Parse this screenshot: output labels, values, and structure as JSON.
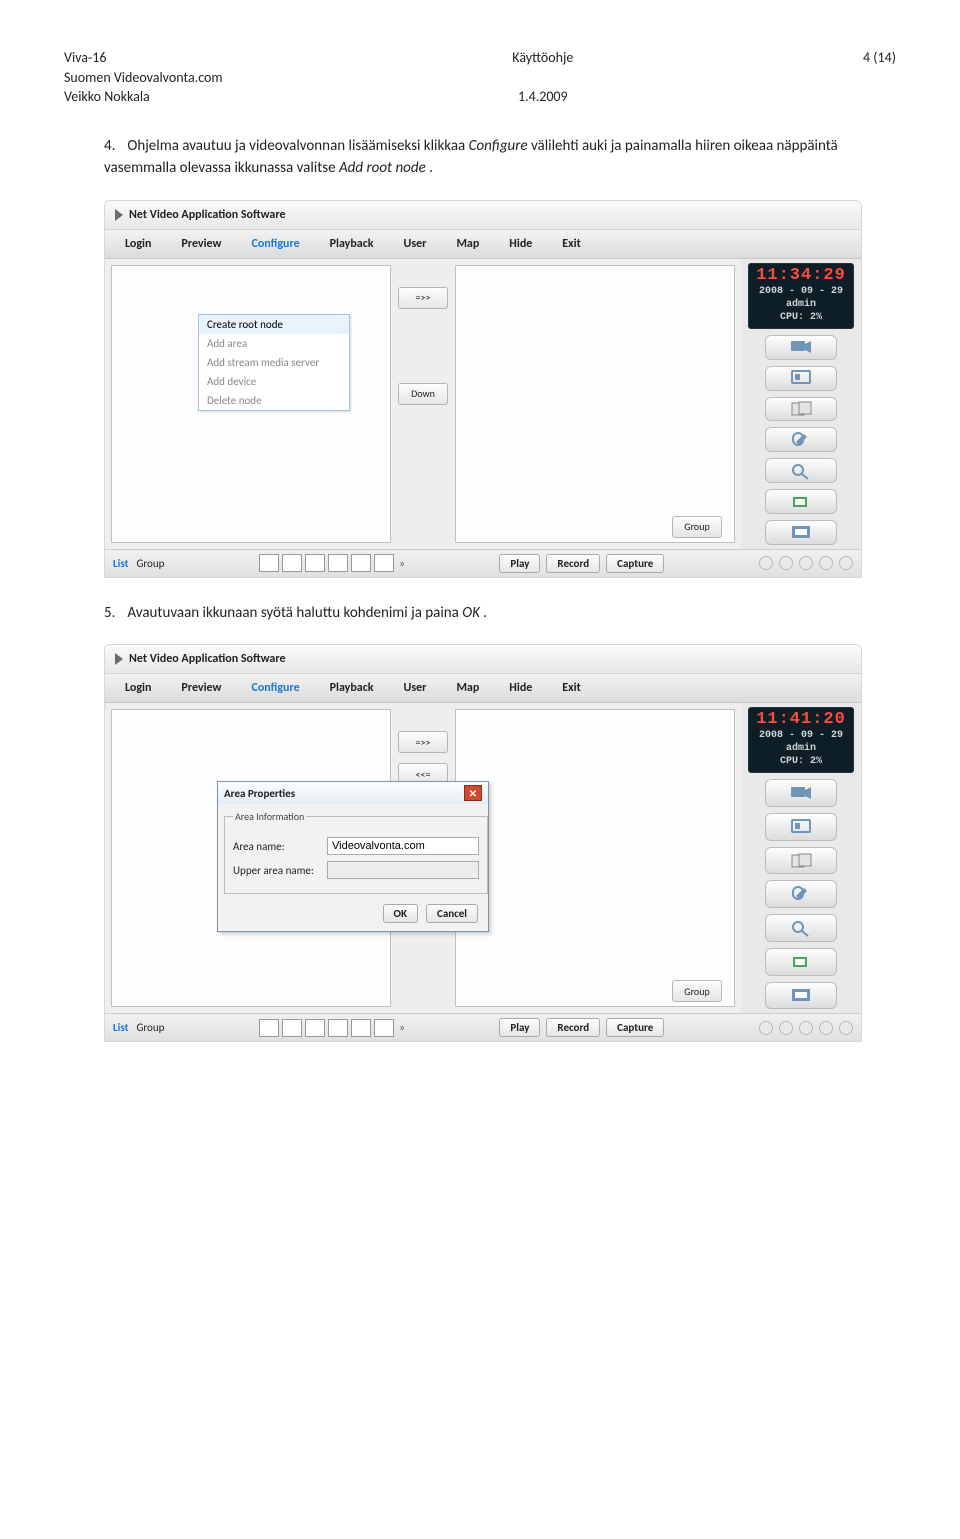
{
  "header": {
    "left_line1": "Viva-16",
    "left_line2": "Suomen Videovalvonta.com",
    "left_line3": "Veikko Nokkala",
    "center_line1": "Käyttöohje",
    "center_line2": "1.4.2009",
    "right_line1": "4 (14)"
  },
  "para4": {
    "num": "4.",
    "t1": "Ohjelma avautuu ja videovalvonnan lisäämiseksi klikkaa ",
    "em1": "Configure",
    "t2": " välilehti auki ja painamalla hiiren oikeaa näppäintä vasemmalla olevassa ikkunassa valitse ",
    "em2": "Add root node",
    "t3": "."
  },
  "para5": {
    "num": "5.",
    "t1": "Avautuvaan ikkunaan syötä haluttu kohdenimi ja paina ",
    "em1": "OK",
    "t2": "."
  },
  "app": {
    "title": "Net Video Application Software",
    "menu": {
      "login": "Login",
      "preview": "Preview",
      "configure": "Configure",
      "playback": "Playback",
      "user": "User",
      "map": "Map",
      "hide": "Hide",
      "exit": "Exit"
    },
    "small": {
      "fwd": "=>>",
      "back": "<<=",
      "down": "Down",
      "group": "Group"
    },
    "footer": {
      "tabs": {
        "list": "List",
        "group": "Group"
      },
      "play": "Play",
      "record": "Record",
      "capture": "Capture",
      "chev": "»"
    }
  },
  "lcd1": {
    "time": "11:34:29",
    "date": "2008 - 09 - 29",
    "user": "admin",
    "cpu": "CPU: 2%"
  },
  "lcd2": {
    "time": "11:41:20",
    "date": "2008 - 09 - 29",
    "user": "admin",
    "cpu": "CPU: 2%"
  },
  "ctx": {
    "create": "Create root node",
    "addarea": "Add area",
    "addstream": "Add stream media server",
    "adddev": "Add device",
    "del": "Delete node"
  },
  "dlg": {
    "title": "Area Properties",
    "legend": "Area Information",
    "l1": "Area name:",
    "v1": "Videovalvonta.com",
    "l2": "Upper area name:",
    "ok": "OK",
    "cancel": "Cancel"
  }
}
